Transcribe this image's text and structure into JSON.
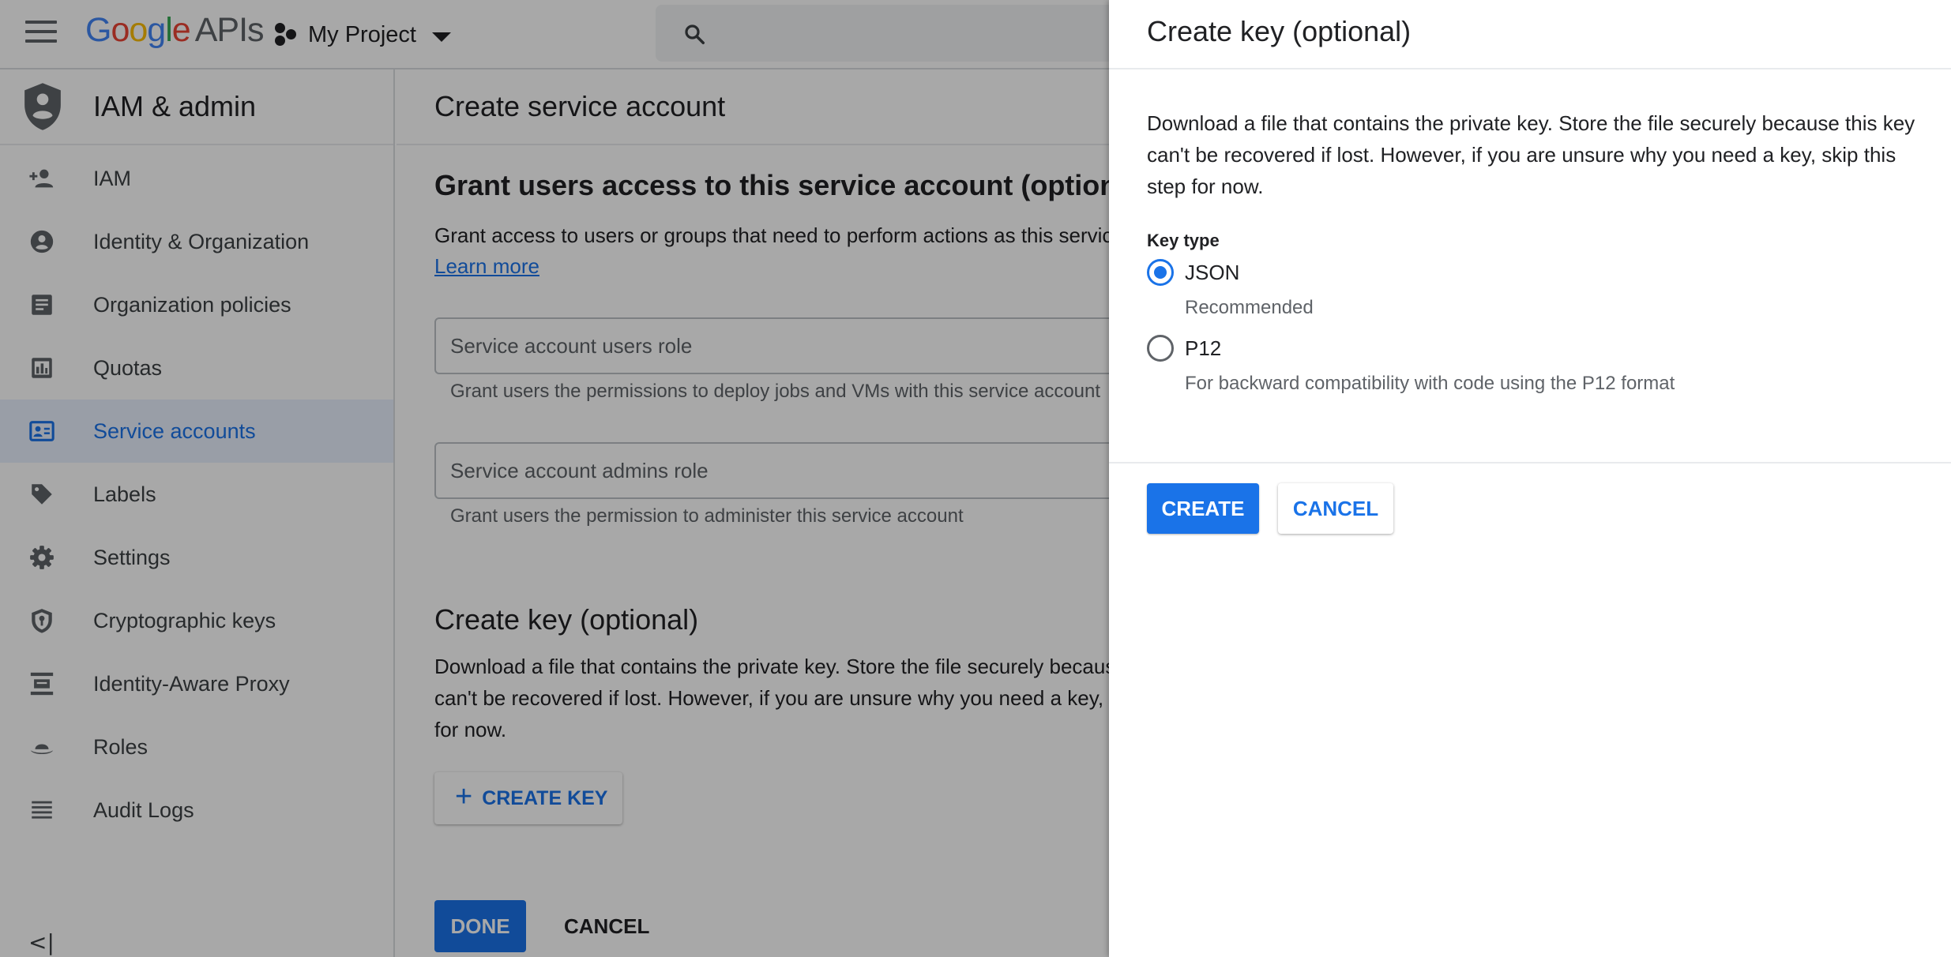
{
  "topbar": {
    "logo_google": [
      "G",
      "o",
      "o",
      "g",
      "l",
      "e"
    ],
    "logo_apis": "APIs",
    "project_name": "My Project",
    "icons": {
      "menu": "hamburger-icon",
      "project": "project-dots-icon",
      "dropdown": "chevron-down-icon",
      "search": "search-icon"
    }
  },
  "sidebar": {
    "title": "IAM & admin",
    "header_icon": "shield-icon",
    "items": [
      {
        "label": "IAM",
        "icon": "person-add-icon"
      },
      {
        "label": "Identity & Organization",
        "icon": "account-circle-icon"
      },
      {
        "label": "Organization policies",
        "icon": "document-icon"
      },
      {
        "label": "Quotas",
        "icon": "quotas-icon"
      },
      {
        "label": "Service accounts",
        "icon": "service-account-icon",
        "active": true
      },
      {
        "label": "Labels",
        "icon": "label-tag-icon"
      },
      {
        "label": "Settings",
        "icon": "gear-icon"
      },
      {
        "label": "Cryptographic keys",
        "icon": "key-shield-icon"
      },
      {
        "label": "Identity-Aware Proxy",
        "icon": "proxy-icon"
      },
      {
        "label": "Roles",
        "icon": "hat-icon"
      },
      {
        "label": "Audit Logs",
        "icon": "list-icon"
      }
    ],
    "collapse_glyph": "<|"
  },
  "main": {
    "title": "Create service account",
    "grant_section": {
      "title": "Grant users access to this service account (optional)",
      "text": "Grant access to users or groups that need to perform actions as this service account.",
      "learn_more": "Learn more",
      "users_role_placeholder": "Service account users role",
      "users_role_hint": "Grant users the permissions to deploy jobs and VMs with this service account",
      "admins_role_placeholder": "Service account admins role",
      "admins_role_hint": "Grant users the permission to administer this service account"
    },
    "key_section": {
      "title": "Create key (optional)",
      "line1": "Download a file that contains the private key. Store the file securely because this key",
      "line2": "can't be recovered if lost. However, if you are unsure why you need a key, skip this step",
      "line3": "for now.",
      "create_key_plus": "+",
      "create_key_label": "CREATE KEY"
    },
    "done_label": "DONE",
    "cancel_label": "CANCEL"
  },
  "panel": {
    "title": "Create key (optional)",
    "description": "Download a file that contains the private key. Store the file securely because this key can't be recovered if lost. However, if you are unsure why you need a key, skip this step for now.",
    "key_type_label": "Key type",
    "options": [
      {
        "label": "JSON",
        "sub": "Recommended",
        "selected": true
      },
      {
        "label": "P12",
        "sub": "For backward compatibility with code using the P12 format",
        "selected": false
      }
    ],
    "create_label": "CREATE",
    "cancel_label": "CANCEL"
  },
  "colors": {
    "accent": "#1a73e8",
    "active_nav_bg": "#e8f0fe",
    "scrim": "rgba(0,0,0,0.34)"
  }
}
